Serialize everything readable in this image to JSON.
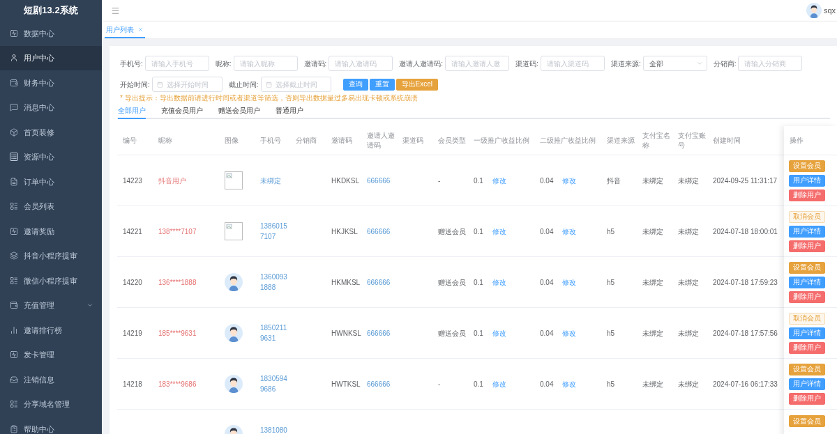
{
  "sidebar": {
    "title": "短剧13.2系统",
    "items": [
      {
        "label": "数据中心",
        "kind": "link",
        "selected": false
      },
      {
        "label": "用户中心",
        "kind": "link",
        "selected": true
      },
      {
        "label": "财务中心",
        "kind": "link",
        "selected": false
      },
      {
        "label": "消息中心",
        "kind": "link",
        "selected": false
      },
      {
        "label": "首页装修",
        "kind": "link",
        "selected": false
      },
      {
        "label": "资源中心",
        "kind": "link",
        "selected": false
      },
      {
        "label": "订单中心",
        "kind": "link",
        "selected": false
      },
      {
        "label": "会员列表",
        "kind": "link",
        "selected": false
      },
      {
        "label": "邀请奖励",
        "kind": "link",
        "selected": false
      },
      {
        "label": "抖音小程序提审",
        "kind": "link",
        "selected": false
      },
      {
        "label": "微信小程序提审",
        "kind": "link",
        "selected": false
      },
      {
        "label": "充值管理",
        "kind": "submenu",
        "selected": false
      },
      {
        "label": "邀请排行榜",
        "kind": "link",
        "selected": false
      },
      {
        "label": "发卡管理",
        "kind": "link",
        "selected": false
      },
      {
        "label": "注销信息",
        "kind": "link",
        "selected": false
      },
      {
        "label": "分享域名管理",
        "kind": "link",
        "selected": false
      },
      {
        "label": "帮助中心",
        "kind": "link",
        "selected": false
      }
    ]
  },
  "navbar": {
    "user": "sqx"
  },
  "tags": [
    {
      "label": "用户列表",
      "selected": true
    }
  ],
  "filters": {
    "fields": [
      {
        "label": "手机号:",
        "kind": "input",
        "placeholder": "请输入手机号"
      },
      {
        "label": "昵称:",
        "kind": "input",
        "placeholder": "请输入昵称"
      },
      {
        "label": "邀请码:",
        "kind": "input",
        "placeholder": "请输入邀请码"
      },
      {
        "label": "邀请人邀请码:",
        "kind": "input",
        "placeholder": "请输入邀请人邀"
      },
      {
        "label": "渠道码:",
        "kind": "input",
        "placeholder": "请输入渠道码"
      },
      {
        "label": "渠道来源:",
        "kind": "select",
        "value": "全部"
      },
      {
        "label": "分销商:",
        "kind": "input",
        "placeholder": "请输入分销商"
      }
    ],
    "dates": [
      {
        "label": "开始时间:",
        "kind": "date",
        "placeholder": "选择开始时间"
      },
      {
        "label": "截止时间:",
        "kind": "date",
        "placeholder": "选择截止时间"
      }
    ],
    "buttons": [
      {
        "label": "查询",
        "kind": "primary"
      },
      {
        "label": "重置",
        "kind": "primary"
      },
      {
        "label": "导出Excel",
        "kind": "warning"
      }
    ],
    "notice": "* 导出提示：导出数据前请进行时间或者渠道等筛选，否则导出数据量过多易出现卡顿或系统崩溃"
  },
  "user_tabs": [
    {
      "label": "全部用户",
      "selected": true
    },
    {
      "label": "充值会员用户",
      "selected": false
    },
    {
      "label": "赠送会员用户",
      "selected": false
    },
    {
      "label": "普通用户",
      "selected": false
    }
  ],
  "table": {
    "columns": [
      "编号",
      "昵称",
      "图像",
      "手机号",
      "分销商",
      "邀请码",
      "邀请人邀请码",
      "渠道码",
      "会员类型",
      "一级推广收益比例",
      "二级推广收益比例",
      "渠道来源",
      "支付宝名称",
      "支付宝账号",
      "创建时间",
      "操作"
    ],
    "rows": [
      {
        "id": "14223",
        "nickname": "抖音用户",
        "image_loaded": false,
        "phone": "未绑定",
        "invite_code": "HKDKSL",
        "inviter_code": "666666",
        "member_type": "-",
        "level1_ratio": "0.1",
        "level1_action": "修改",
        "level2_ratio": "0.04",
        "level2_action": "修改",
        "channel_source": "抖音",
        "alipay_name": "未绑定",
        "alipay_account": "未绑定",
        "created_at": "2024-09-25 11:31:17",
        "actions": [
          {
            "label": "设置会员",
            "kind": "warning"
          },
          {
            "label": "用户详情",
            "kind": "primary"
          },
          {
            "label": "删除用户",
            "kind": "danger"
          }
        ]
      },
      {
        "id": "14221",
        "nickname": "138****7107",
        "image_loaded": false,
        "phone": "13860157107",
        "invite_code": "HKJKSL",
        "inviter_code": "666666",
        "member_type": "赠送会员",
        "level1_ratio": "0.1",
        "level1_action": "修改",
        "level2_ratio": "0.04",
        "level2_action": "修改",
        "channel_source": "h5",
        "alipay_name": "未绑定",
        "alipay_account": "未绑定",
        "created_at": "2024-07-18 18:00:01",
        "actions": [
          {
            "label": "取消会员",
            "kind": "warning-plain"
          },
          {
            "label": "用户详情",
            "kind": "primary"
          },
          {
            "label": "删除用户",
            "kind": "danger"
          }
        ]
      },
      {
        "id": "14220",
        "nickname": "136****1888",
        "image_loaded": true,
        "phone": "13600931888",
        "invite_code": "HKMKSL",
        "inviter_code": "666666",
        "member_type": "赠送会员",
        "level1_ratio": "0.1",
        "level1_action": "修改",
        "level2_ratio": "0.04",
        "level2_action": "修改",
        "channel_source": "h5",
        "alipay_name": "未绑定",
        "alipay_account": "未绑定",
        "created_at": "2024-07-18 17:59:23",
        "actions": [
          {
            "label": "设置会员",
            "kind": "warning"
          },
          {
            "label": "用户详情",
            "kind": "primary"
          },
          {
            "label": "删除用户",
            "kind": "danger"
          }
        ]
      },
      {
        "id": "14219",
        "nickname": "185****9631",
        "image_loaded": true,
        "phone": "18502119631",
        "invite_code": "HWNKSL",
        "inviter_code": "666666",
        "member_type": "赠送会员",
        "level1_ratio": "0.1",
        "level1_action": "修改",
        "level2_ratio": "0.04",
        "level2_action": "修改",
        "channel_source": "h5",
        "alipay_name": "未绑定",
        "alipay_account": "未绑定",
        "created_at": "2024-07-18 17:57:56",
        "actions": [
          {
            "label": "取消会员",
            "kind": "warning-plain"
          },
          {
            "label": "用户详情",
            "kind": "primary"
          },
          {
            "label": "删除用户",
            "kind": "danger"
          }
        ]
      },
      {
        "id": "14218",
        "nickname": "183****9686",
        "image_loaded": true,
        "phone": "18305949686",
        "invite_code": "HWTKSL",
        "inviter_code": "666666",
        "member_type": "-",
        "level1_ratio": "0.1",
        "level1_action": "修改",
        "level2_ratio": "0.04",
        "level2_action": "修改",
        "channel_source": "h5",
        "alipay_name": "未绑定",
        "alipay_account": "未绑定",
        "created_at": "2024-07-16 06:17:33",
        "actions": [
          {
            "label": "设置会员",
            "kind": "warning"
          },
          {
            "label": "用户详情",
            "kind": "primary"
          },
          {
            "label": "删除用户",
            "kind": "danger"
          }
        ]
      },
      {
        "image_loaded": true,
        "phone": "1381080",
        "actions": [
          {
            "label": "设置会员",
            "kind": "warning"
          }
        ]
      }
    ]
  }
}
